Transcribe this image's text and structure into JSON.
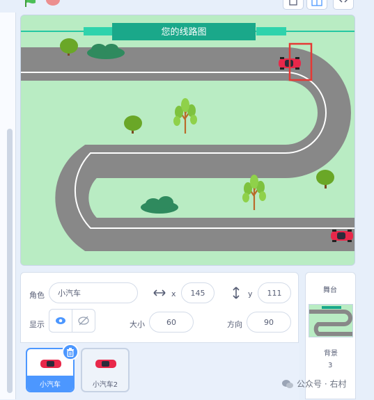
{
  "stage": {
    "banner_title": "您的线路图"
  },
  "sprite_info": {
    "sprite_label": "角色",
    "sprite_name": "小汽车",
    "x_label": "x",
    "x_value": "145",
    "y_label": "y",
    "y_value": "111",
    "show_label": "显示",
    "size_label": "大小",
    "size_value": "60",
    "direction_label": "方向",
    "direction_value": "90"
  },
  "sprites": [
    {
      "name": "小汽车",
      "selected": true
    },
    {
      "name": "小汽车2",
      "selected": false
    }
  ],
  "stage_panel": {
    "title": "舞台",
    "backdrop_label": "背景",
    "backdrop_count": "3"
  },
  "watermark": {
    "text": "公众号 · 右村"
  },
  "colors": {
    "accent": "#4c97ff",
    "stage_bg": "#b9ecc3",
    "road": "#888888",
    "banner": "#1aa88a",
    "highlight_box": "#e53935"
  }
}
